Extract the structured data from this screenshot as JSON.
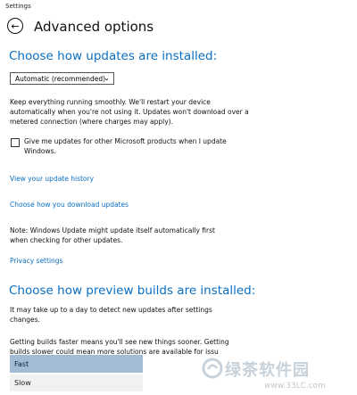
{
  "window": {
    "title": "Settings"
  },
  "header": {
    "title": "Advanced options"
  },
  "updates_section": {
    "heading": "Choose how updates are installed:",
    "dropdown_value": "Automatic (recommended)",
    "description": "Keep everything running smoothly. We'll restart your device automatically when you're not using it. Updates won't download over a metered connection (where charges may apply).",
    "checkbox_label": "Give me updates for other Microsoft products when I update Windows.",
    "checkbox_checked": false
  },
  "links": {
    "history": "View your update history",
    "download": "Choose how you download updates",
    "privacy": "Privacy settings"
  },
  "note": "Note: Windows Update might update itself automatically first when checking for other updates.",
  "preview_section": {
    "heading": "Choose how preview builds are installed:",
    "text1": "It may take up to a day to detect new updates after settings changes.",
    "text2": "Getting builds faster means you'll see new things sooner. Getting builds slower could mean more solutions are available for issu",
    "options": [
      "Fast",
      "Slow"
    ],
    "selected": "Fast"
  },
  "watermark": {
    "brand": "绿茶软件园",
    "url": "www.33LC.com"
  },
  "icons": {
    "back": "back-arrow-icon",
    "dropdown": "chevron-down-icon"
  }
}
